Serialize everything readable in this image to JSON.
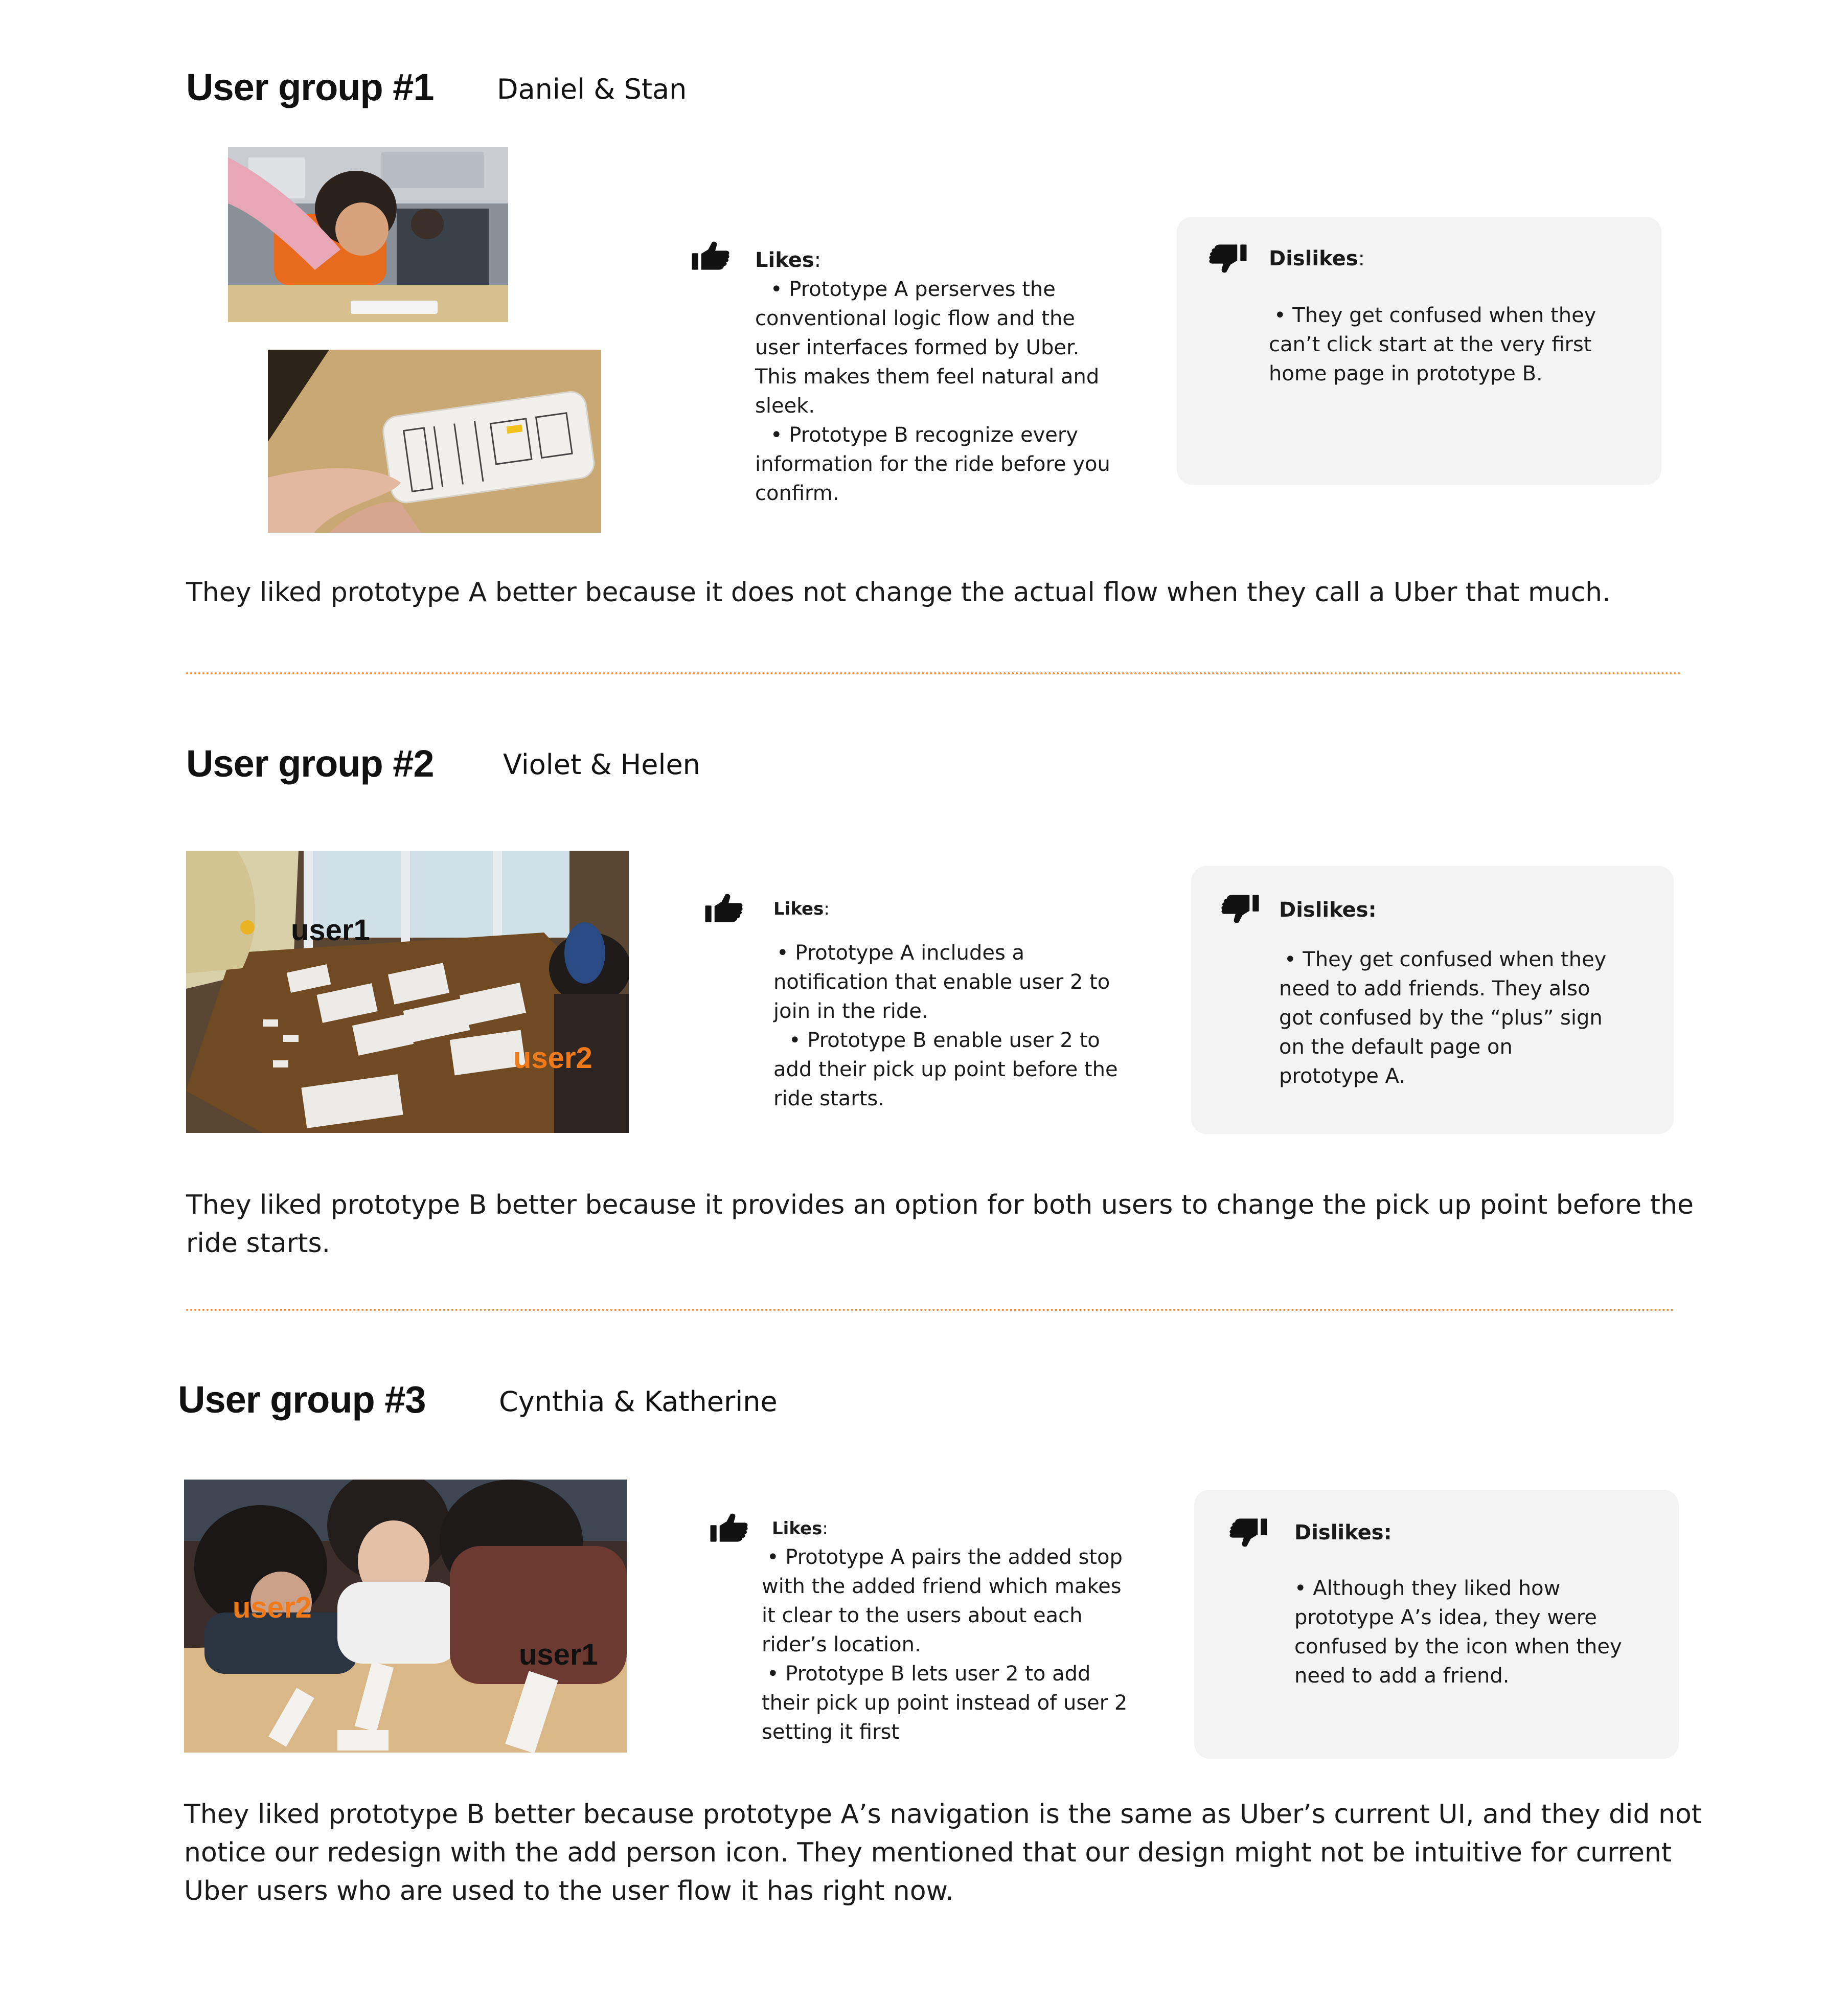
{
  "colors": {
    "accent": "#f08a2c",
    "card_bg": "#f4f3f4",
    "text": "#1a1a1a"
  },
  "icons": {
    "likes": "thumbs-up-icon",
    "dislikes": "thumbs-down-icon"
  },
  "groups": [
    {
      "title": "User group #1",
      "names": "Daniel & Stan",
      "likes": {
        "label": "Likes",
        "suffix": ":",
        "lines": [
          "• Prototype A perserves the",
          "conventional logic flow and the",
          "user interfaces formed by Uber.",
          "This makes them feel natural and",
          "sleek.",
          "• Prototype B recognize every",
          "information for the ride before you",
          "confirm."
        ]
      },
      "dislikes": {
        "label": "Dislikes",
        "suffix": ":",
        "lines": [
          "• They get confused when they",
          "can’t click start at the very first",
          "home page in prototype B."
        ]
      },
      "summary": [
        "They liked prototype A better because it does not change the actual flow when they call a Uber that much."
      ]
    },
    {
      "title": "User group #2",
      "names": "Violet & Helen",
      "photo_labels": {
        "user1": "user1",
        "user2": "user2"
      },
      "likes": {
        "label": "Likes",
        "suffix": ":",
        "lines": [
          "• Prototype A includes a",
          "notification that enable user 2 to",
          "join in the ride.",
          "• Prototype B enable user 2 to",
          "add their pick up point before the",
          "ride starts."
        ]
      },
      "dislikes": {
        "label": "Dislikes:",
        "lines": [
          "• They get confused when they",
          "need to add friends. They also",
          "got confused by the “plus” sign",
          "on the default page on",
          "prototype A."
        ]
      },
      "summary": [
        "They liked prototype B better because it provides an option for both users to change the pick up point before the",
        "ride starts."
      ]
    },
    {
      "title": "User group #3",
      "names": "Cynthia & Katherine",
      "photo_labels": {
        "user1": "user1",
        "user2": "user2"
      },
      "likes": {
        "label": "Likes",
        "suffix": ":",
        "lines": [
          "• Prototype A pairs the added stop",
          "with the added friend which makes",
          "it clear to the users about each",
          "rider’s location.",
          "• Prototype B lets user 2 to add",
          "their pick up point instead of user 2",
          "setting it first"
        ]
      },
      "dislikes": {
        "label": "Dislikes:",
        "lines": [
          "• Although they liked how",
          "prototype A’s idea, they were",
          "confused by the icon when they",
          "need to add a friend."
        ]
      },
      "summary": [
        "They liked prototype B better because prototype A’s navigation is the same as Uber’s current UI, and they did not",
        "notice our redesign with the add person icon. They mentioned that our design might not be intuitive for current",
        "Uber users who are used to the user flow it has right now."
      ]
    }
  ]
}
